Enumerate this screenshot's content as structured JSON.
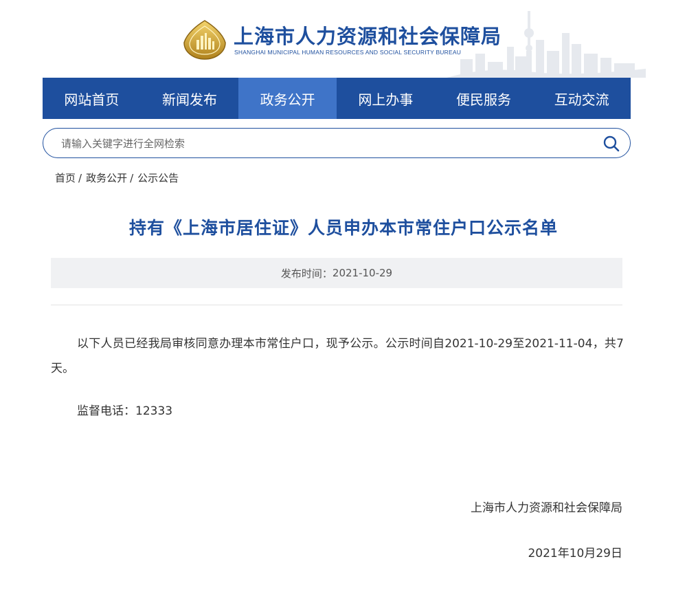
{
  "header": {
    "title_cn": "上海市人力资源和社会保障局",
    "title_en": "SHANGHAI MUNICIPAL HUMAN RESOURCES AND SOCIAL SECURITY BUREAU"
  },
  "nav": {
    "items": [
      {
        "label": "网站首页"
      },
      {
        "label": "新闻发布"
      },
      {
        "label": "政务公开"
      },
      {
        "label": "网上办事"
      },
      {
        "label": "便民服务"
      },
      {
        "label": "互动交流"
      }
    ],
    "active_index": 2
  },
  "search": {
    "placeholder": "请输入关键字进行全网检索"
  },
  "breadcrumb": {
    "items": [
      "首页",
      "政务公开",
      "公示公告"
    ],
    "separator": "/"
  },
  "article": {
    "title": "持有《上海市居住证》人员申办本市常住户口公示名单",
    "publish_label": "发布时间：",
    "publish_date": "2021-10-29",
    "paragraph1": "以下人员已经我局审核同意办理本市常住户口，现予公示。公示时间自2021-10-29至2021-11-04，共7天。",
    "paragraph2": "监督电话：12333",
    "signature_org": "上海市人力资源和社会保障局",
    "signature_date": "2021年10月29日"
  },
  "colors": {
    "brand_blue": "#1e4f9e",
    "nav_active": "#3f74c8",
    "meta_bg": "#f0f1f3"
  }
}
